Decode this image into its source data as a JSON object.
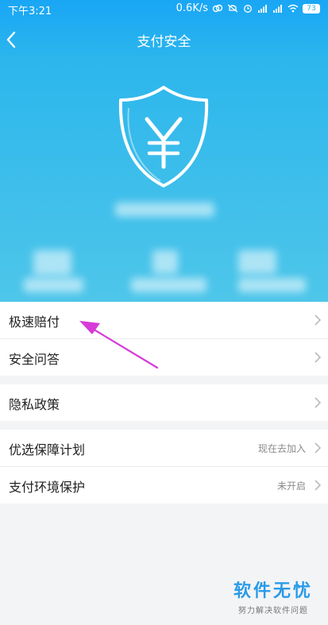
{
  "status_bar": {
    "time": "下午3:21",
    "net_speed": "0.6K/s",
    "battery": "73"
  },
  "nav": {
    "title": "支付安全"
  },
  "icons": {
    "back": "back-arrow-icon",
    "shield": "shield-yen-icon",
    "chevron": "chevron-right-icon"
  },
  "colors": {
    "header_top": "#19a6f5",
    "header_bottom": "#4ec6ea",
    "annotation": "#d63ad8",
    "watermark": "#2b9be8"
  },
  "menu_groups": [
    [
      {
        "label": "极速赔付",
        "value": ""
      },
      {
        "label": "安全问答",
        "value": ""
      }
    ],
    [
      {
        "label": "隐私政策",
        "value": ""
      }
    ],
    [
      {
        "label": "优选保障计划",
        "value": "现在去加入"
      },
      {
        "label": "支付环境保护",
        "value": "未开启"
      }
    ]
  ],
  "watermark": {
    "title": "软件无忧",
    "subtitle": "努力解决软件问题"
  }
}
